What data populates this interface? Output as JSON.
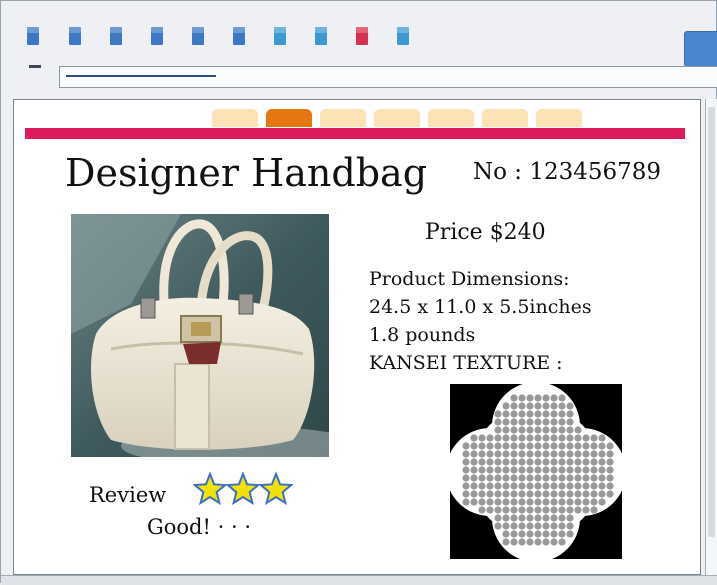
{
  "toolbar": {
    "buttons": [
      {
        "icon": "toolbar-button-icon",
        "color": "#3d78c4"
      },
      {
        "icon": "toolbar-button-icon",
        "color": "#3d78c4"
      },
      {
        "icon": "toolbar-button-icon",
        "color": "#3d78c4"
      },
      {
        "icon": "toolbar-button-icon",
        "color": "#3d78c4"
      },
      {
        "icon": "toolbar-button-icon",
        "color": "#3d78c4"
      },
      {
        "icon": "toolbar-button-icon",
        "color": "#3d78c4"
      },
      {
        "icon": "toolbar-button-icon",
        "color": "#3d9ad1"
      },
      {
        "icon": "toolbar-button-icon",
        "color": "#3d9ad1"
      },
      {
        "icon": "toolbar-button-icon",
        "color": "#d8304f"
      },
      {
        "icon": "toolbar-button-icon",
        "color": "#3d9ad1"
      }
    ],
    "page_load_progress": 0.25
  },
  "page_tabs": {
    "count": 7,
    "active_index": 1,
    "colors": {
      "inactive": "#fbe3b6",
      "active": "#e6770e"
    }
  },
  "accent_bar_color": "#de1b5a",
  "product": {
    "title": "Designer Handbag",
    "number": "No : 123456789",
    "price": "Price $240",
    "dimensions_label": "Product Dimensions:",
    "dimensions": "24.5 x 11.0 x 5.5inches",
    "weight": "1.8 pounds",
    "texture_label": "KANSEI TEXTURE :",
    "review_label": "Review",
    "rating": 3,
    "rating_max": 3,
    "review_text": "Good! · · ·"
  }
}
